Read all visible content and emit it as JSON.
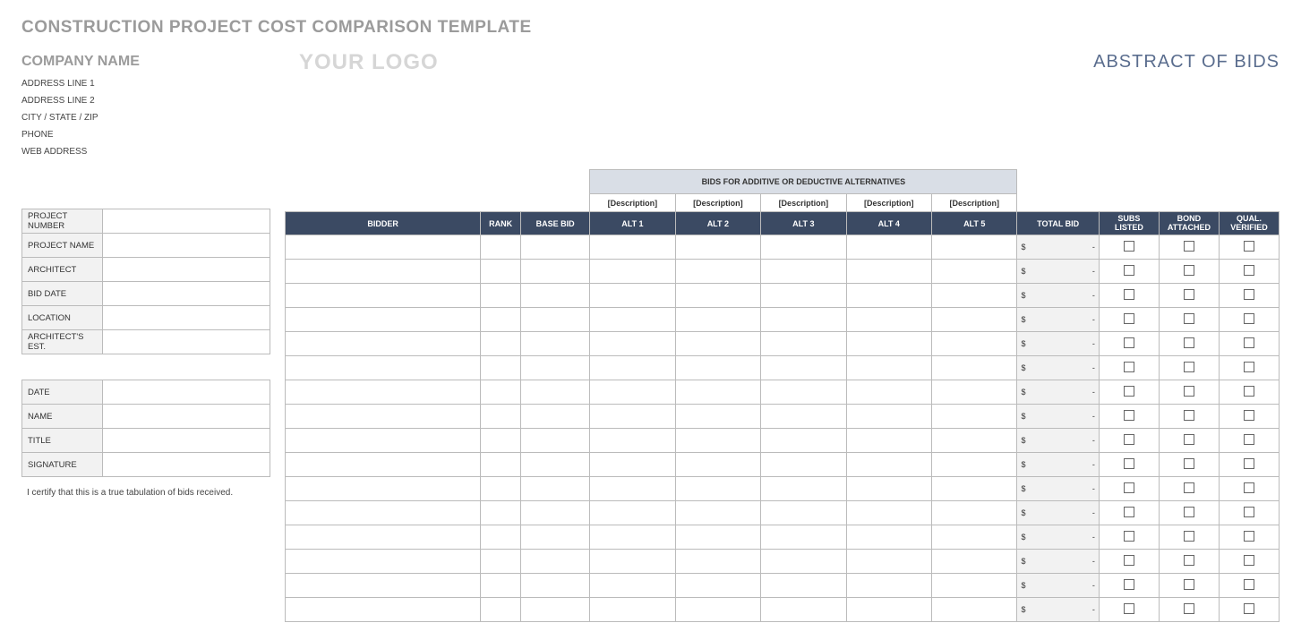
{
  "title": "CONSTRUCTION PROJECT COST COMPARISON TEMPLATE",
  "company": {
    "name": "COMPANY NAME",
    "address1": "ADDRESS LINE 1",
    "address2": "ADDRESS LINE 2",
    "city_state_zip": "CITY / STATE / ZIP",
    "phone": "PHONE",
    "web": "WEB ADDRESS"
  },
  "logo_text": "YOUR LOGO",
  "abstract_label": "ABSTRACT OF BIDS",
  "project_info_labels": {
    "project_number": "PROJECT NUMBER",
    "project_name": "PROJECT NAME",
    "architect": "ARCHITECT",
    "bid_date": "BID DATE",
    "location": "LOCATION",
    "architects_est": "ARCHITECT'S EST."
  },
  "signoff_labels": {
    "date": "DATE",
    "name": "NAME",
    "title": "TITLE",
    "signature": "SIGNATURE"
  },
  "cert_text": "I certify that this is a true tabulation of bids received.",
  "alternatives_header": "BIDS FOR ADDITIVE OR DEDUCTIVE ALTERNATIVES",
  "description_placeholder": "[Description]",
  "columns": {
    "bidder": "BIDDER",
    "rank": "RANK",
    "base_bid": "BASE BID",
    "alt1": "ALT 1",
    "alt2": "ALT 2",
    "alt3": "ALT 3",
    "alt4": "ALT 4",
    "alt5": "ALT 5",
    "total_bid": "TOTAL BID",
    "subs_listed": "SUBS LISTED",
    "bond_attached": "BOND ATTACHED",
    "qual_verified": "QUAL. VERIFIED"
  },
  "total_display": {
    "currency": "$",
    "dash": "-"
  },
  "row_count": 16
}
